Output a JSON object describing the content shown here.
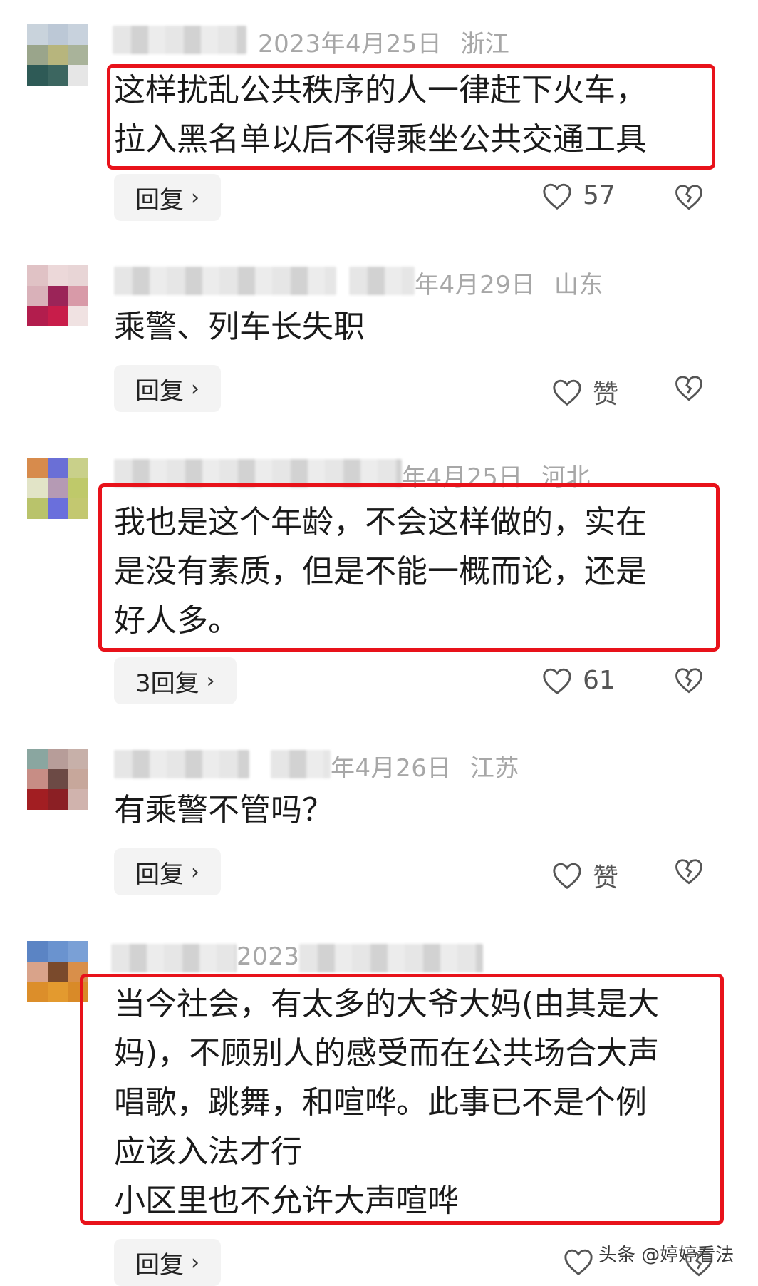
{
  "comments": [
    {
      "date": "2023年4月25日",
      "location": "浙江",
      "lines": [
        "这样扰乱公共秩序的人一律赶下火车，",
        "拉入黑名单以后不得乘坐公共交通工具"
      ],
      "reply_label": "回复",
      "likes": "57"
    },
    {
      "date": "年4月29日",
      "location": "山东",
      "lines": [
        "乘警、列车长失职"
      ],
      "reply_label": "回复",
      "likes": "赞"
    },
    {
      "date": "年4月25日",
      "location": "河北",
      "lines": [
        "我也是这个年龄，不会这样做的，实在",
        "是没有素质，但是不能一概而论，还是",
        "好人多。"
      ],
      "reply_label": "3回复",
      "likes": "61"
    },
    {
      "date": "年4月26日",
      "location": "江苏",
      "lines": [
        "有乘警不管吗？"
      ],
      "reply_label": "回复",
      "likes": "赞"
    },
    {
      "date": "2023",
      "location": "",
      "lines": [
        "当今社会，有太多的大爷大妈(由其是大",
        "妈)，不顾别人的感受而在公共场合大声",
        "唱歌，跳舞，和喧哗。此事已不是个例",
        "应该入法才行",
        "小区里也不允许大声喧哗"
      ],
      "reply_label": "回复",
      "likes": ""
    }
  ],
  "watermark": "头条 @婷婷看法",
  "colors": {
    "highlight_border": "#e8121a",
    "meta_text": "#a7a7a7",
    "reply_bg": "#f3f3f3"
  },
  "icons": [
    "heart-outline-icon",
    "broken-heart-icon",
    "chevron-right-icon"
  ]
}
